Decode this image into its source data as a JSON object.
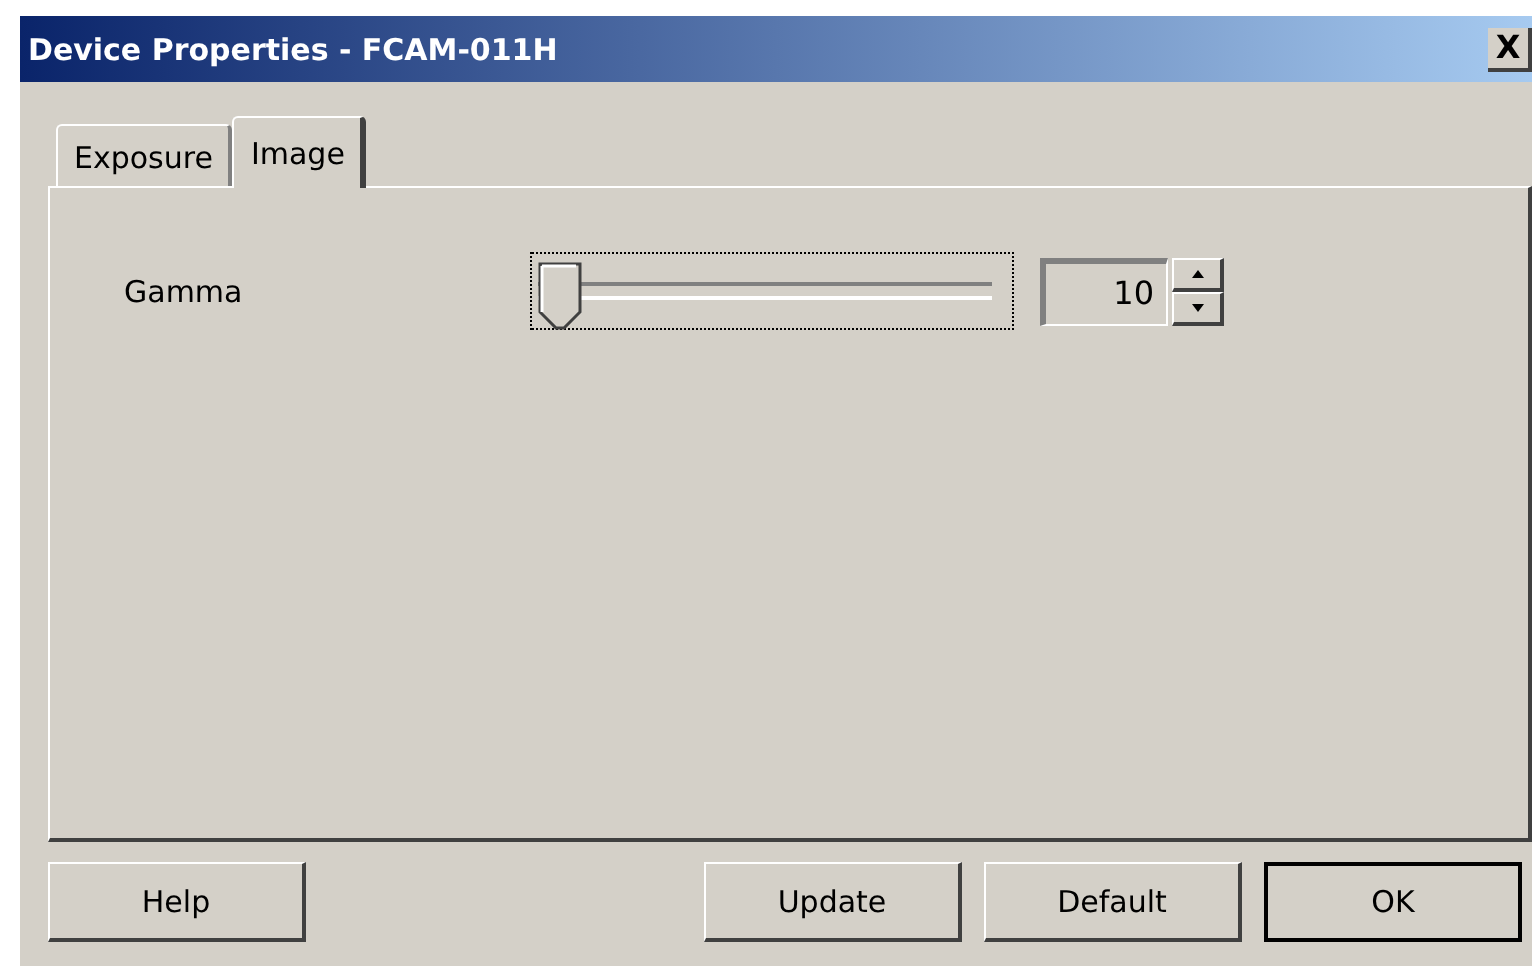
{
  "window": {
    "title": "Device Properties - FCAM-011H",
    "close": "X"
  },
  "tabs": [
    {
      "label": "Exposure",
      "selected": false
    },
    {
      "label": "Image",
      "selected": true
    }
  ],
  "settings": [
    {
      "label": "Gamma",
      "level": 0,
      "value": "10",
      "focused": true
    }
  ],
  "buttons": [
    {
      "label": "Help",
      "default": false
    },
    {
      "label": "Update",
      "default": false
    },
    {
      "label": "Default",
      "default": false
    },
    {
      "label": "OK",
      "default": true
    }
  ]
}
